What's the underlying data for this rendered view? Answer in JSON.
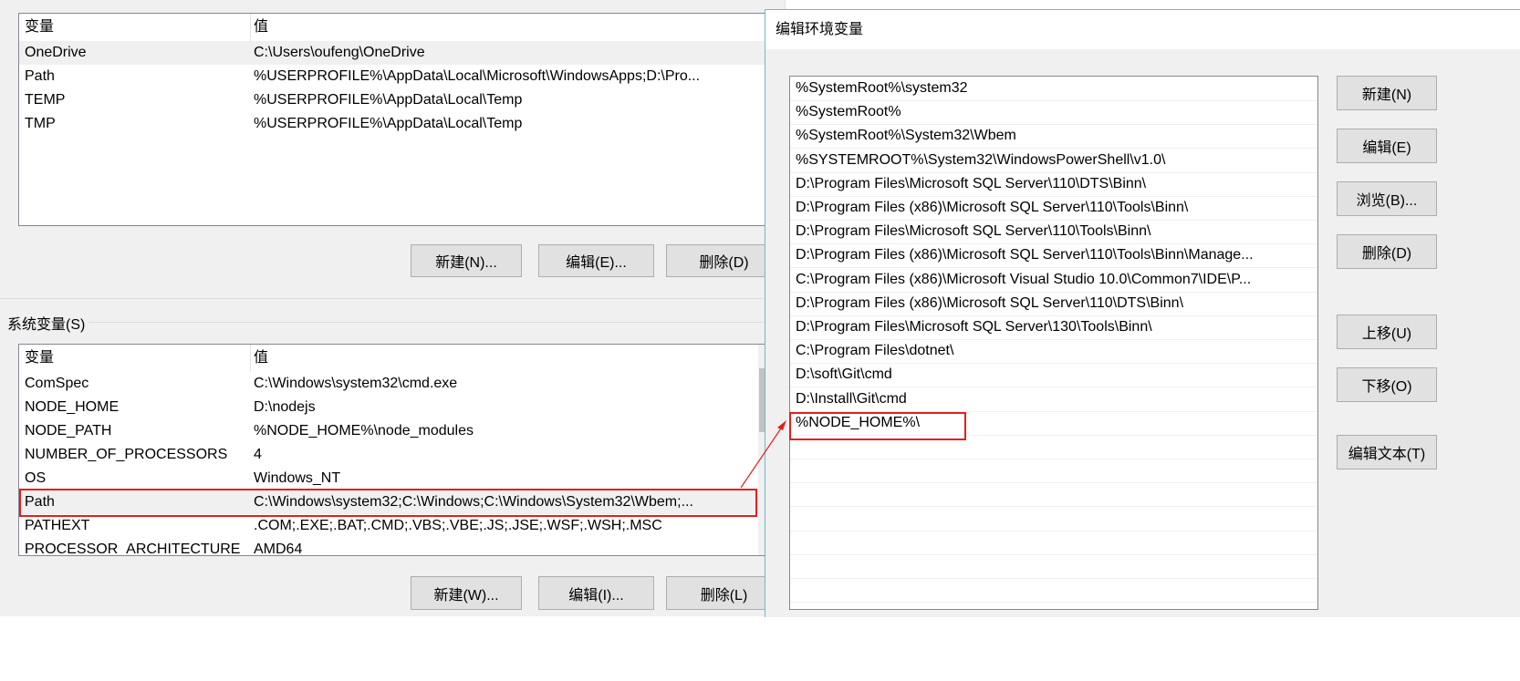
{
  "user_vars": {
    "columns": [
      "变量",
      "值"
    ],
    "rows": [
      {
        "name": "OneDrive",
        "value": "C:\\Users\\oufeng\\OneDrive"
      },
      {
        "name": "Path",
        "value": "%USERPROFILE%\\AppData\\Local\\Microsoft\\WindowsApps;D:\\Pro..."
      },
      {
        "name": "TEMP",
        "value": "%USERPROFILE%\\AppData\\Local\\Temp"
      },
      {
        "name": "TMP",
        "value": "%USERPROFILE%\\AppData\\Local\\Temp"
      }
    ],
    "buttons": {
      "new": "新建(N)...",
      "edit": "编辑(E)...",
      "delete": "删除(D)"
    }
  },
  "system_vars": {
    "group_label": "系统变量(S)",
    "columns": [
      "变量",
      "值"
    ],
    "rows": [
      {
        "name": "ComSpec",
        "value": "C:\\Windows\\system32\\cmd.exe"
      },
      {
        "name": "NODE_HOME",
        "value": "D:\\nodejs"
      },
      {
        "name": "NODE_PATH",
        "value": "%NODE_HOME%\\node_modules"
      },
      {
        "name": "NUMBER_OF_PROCESSORS",
        "value": "4"
      },
      {
        "name": "OS",
        "value": "Windows_NT"
      },
      {
        "name": "Path",
        "value": "C:\\Windows\\system32;C:\\Windows;C:\\Windows\\System32\\Wbem;..."
      },
      {
        "name": "PATHEXT",
        "value": ".COM;.EXE;.BAT;.CMD;.VBS;.VBE;.JS;.JSE;.WSF;.WSH;.MSC"
      },
      {
        "name": "PROCESSOR_ARCHITECTURE",
        "value": "AMD64"
      }
    ],
    "buttons": {
      "new": "新建(W)...",
      "edit": "编辑(I)...",
      "delete": "删除(L)"
    }
  },
  "dialog": {
    "title": "编辑环境变量",
    "paths": [
      "%SystemRoot%\\system32",
      "%SystemRoot%",
      "%SystemRoot%\\System32\\Wbem",
      "%SYSTEMROOT%\\System32\\WindowsPowerShell\\v1.0\\",
      "D:\\Program Files\\Microsoft SQL Server\\110\\DTS\\Binn\\",
      "D:\\Program Files (x86)\\Microsoft SQL Server\\110\\Tools\\Binn\\",
      "D:\\Program Files\\Microsoft SQL Server\\110\\Tools\\Binn\\",
      "D:\\Program Files (x86)\\Microsoft SQL Server\\110\\Tools\\Binn\\Manage...",
      "C:\\Program Files (x86)\\Microsoft Visual Studio 10.0\\Common7\\IDE\\P...",
      "D:\\Program Files (x86)\\Microsoft SQL Server\\110\\DTS\\Binn\\",
      "D:\\Program Files\\Microsoft SQL Server\\130\\Tools\\Binn\\",
      "C:\\Program Files\\dotnet\\",
      "D:\\soft\\Git\\cmd",
      "D:\\Install\\Git\\cmd",
      "%NODE_HOME%\\"
    ],
    "buttons": {
      "new": "新建(N)",
      "edit": "编辑(E)",
      "browse": "浏览(B)...",
      "delete": "删除(D)",
      "up": "上移(U)",
      "down": "下移(O)",
      "edit_text": "编辑文本(T)"
    }
  },
  "colors": {
    "highlight": "#e02020",
    "accent": "#6fb7c7"
  }
}
